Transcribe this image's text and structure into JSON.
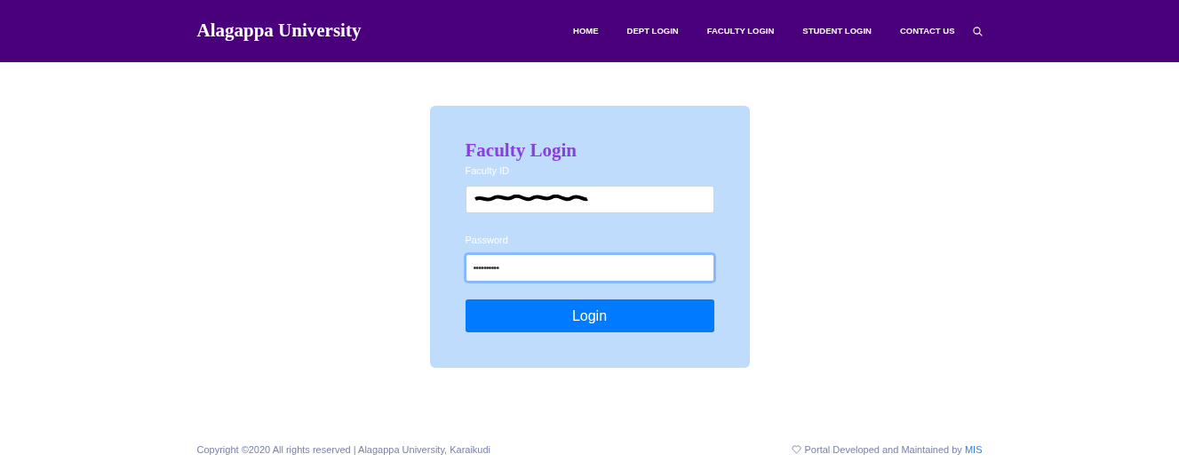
{
  "navbar": {
    "brand": "Alagappa University",
    "links": [
      {
        "label": "HOME",
        "selected": false
      },
      {
        "label": "DEPT LOGIN",
        "selected": false
      },
      {
        "label": "FACULTY LOGIN",
        "selected": false
      },
      {
        "label": "STUDENT LOGIN",
        "selected": false
      },
      {
        "label": "CONTACT US",
        "selected": false
      }
    ]
  },
  "login_form": {
    "title": "Faculty Login",
    "fields": [
      {
        "label": "Faculty ID",
        "kind": "redacted",
        "focused": false
      },
      {
        "label": "Password",
        "kind": "text",
        "value": "••••••••••",
        "focused": true
      }
    ],
    "button": "Login"
  },
  "footer": {
    "copyright": "Copyright ©2020 All rights reserved | Alagappa University, Karaikudi",
    "credit": "Portal Developed and Maintained by",
    "credit_link": "MIS"
  }
}
